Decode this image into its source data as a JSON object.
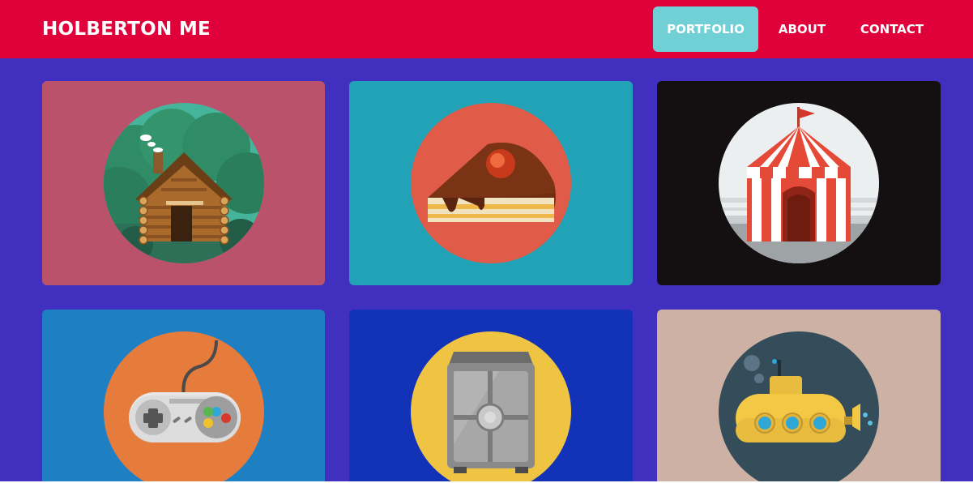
{
  "header": {
    "brand": "HOLBERTON ME",
    "color": "#e0003a",
    "nav": [
      {
        "label": "PORTFOLIO",
        "active": true,
        "active_color": "#71cfd6"
      },
      {
        "label": "ABOUT",
        "active": false
      },
      {
        "label": "CONTACT",
        "active": false
      }
    ]
  },
  "main": {
    "background": "#4130c0",
    "portfolio": [
      {
        "icon": "log-cabin-icon",
        "background": "#b9526a",
        "circle": "#3b9b7a"
      },
      {
        "icon": "cake-slice-icon",
        "background": "#22a2b6",
        "circle": "#e05b48"
      },
      {
        "icon": "circus-tent-icon",
        "background": "#141011",
        "circle": "#eceff0"
      },
      {
        "icon": "game-controller-icon",
        "background": "#1e80c2",
        "circle": "#e57c3c"
      },
      {
        "icon": "safe-icon",
        "background": "#1232b8",
        "circle": "#efc443"
      },
      {
        "icon": "submarine-icon",
        "background": "#cdb1a5",
        "circle": "#354d5b"
      }
    ]
  }
}
